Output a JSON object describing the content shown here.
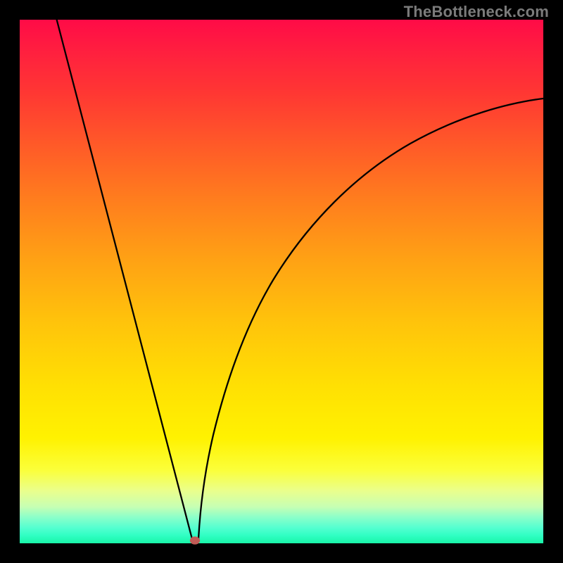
{
  "watermark": "TheBottleneck.com",
  "chart_data": {
    "type": "line",
    "title": "",
    "xlabel": "",
    "ylabel": "",
    "xlim": [
      0,
      100
    ],
    "ylim": [
      0,
      100
    ],
    "grid": false,
    "legend": false,
    "background_gradient": {
      "top_color": "#ff0b47",
      "bottom_color": "#19f5a7",
      "interpretation": "vertical red-to-green gradient; red at y=100, green at y=0"
    },
    "series": [
      {
        "name": "curve",
        "color": "#000000",
        "x": [
          7,
          12,
          16,
          20,
          24,
          28,
          32,
          33,
          34,
          36,
          40,
          46,
          54,
          64,
          76,
          88,
          100
        ],
        "values": [
          100,
          81,
          66,
          51,
          35,
          20,
          5,
          1,
          1,
          6,
          21,
          40,
          58,
          72,
          81,
          85,
          86
        ]
      }
    ],
    "marker": {
      "x": 33.5,
      "y": 0.5,
      "color": "#c15b56",
      "shape": "ellipse",
      "note": "red marker at curve minimum"
    }
  }
}
